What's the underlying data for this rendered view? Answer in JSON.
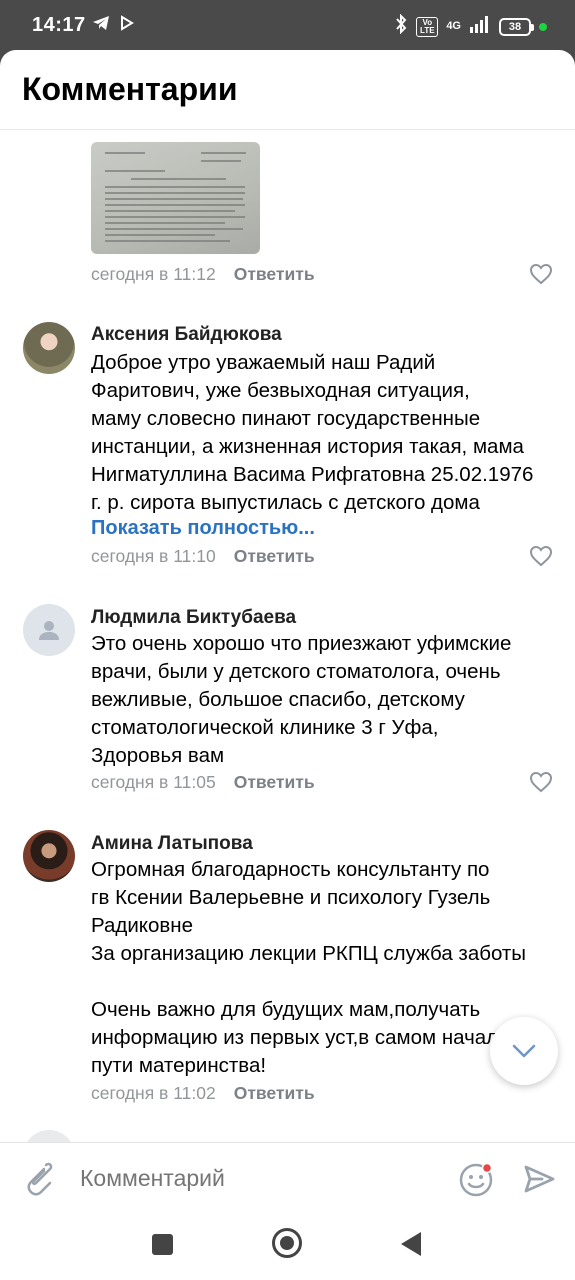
{
  "status_bar": {
    "time": "14:17",
    "network_label": "4G",
    "volte_label": "Vo LTE",
    "battery": "38"
  },
  "header": {
    "title": "Комментарии"
  },
  "top_comment": {
    "time": "сегодня в 11:12",
    "reply_label": "Ответить"
  },
  "comments": [
    {
      "author": "Аксения Байдюкова",
      "text": "Доброе утро уважаемый  наш Радий\nФаритович, уже безвыходная  ситуация,\nмаму словесно пинают государственные\nинстанции, а жизненная история такая, мама\nНигматуллина Васима Рифгатовна 25.02.1976\nг. р. сирота выпустилась  с детского дома",
      "show_more": "Показать полностью...",
      "time": "сегодня в 11:10",
      "reply_label": "Ответить"
    },
    {
      "author": "Людмила Биктубаева",
      "text": "Это очень хорошо что приезжают уфимские\nврачи, были у детского стоматолога, очень\nвежливые, большое спасибо, детскому\nстоматологической клинике 3  г Уфа,\nЗдоровья вам",
      "time": "сегодня в 11:05",
      "reply_label": "Ответить"
    },
    {
      "author": "Амина Латыпова",
      "text": "Огромная благодарность консультанту по\nгв Ксении Валерьевне и психологу Гузель\nРадиковне\nЗа организацию лекции РКПЦ служба заботы\n\nОчень важно для будущих мам,получать\nинформацию из первых уст,в самом начале\nпути материнства!",
      "time": "сегодня в 11:02",
      "reply_label": "Ответить"
    }
  ],
  "input": {
    "placeholder": "Комментарий"
  },
  "colors": {
    "link": "#2a72c2",
    "accent_send": "#99a2ad",
    "notification_dot": "#e64646"
  }
}
